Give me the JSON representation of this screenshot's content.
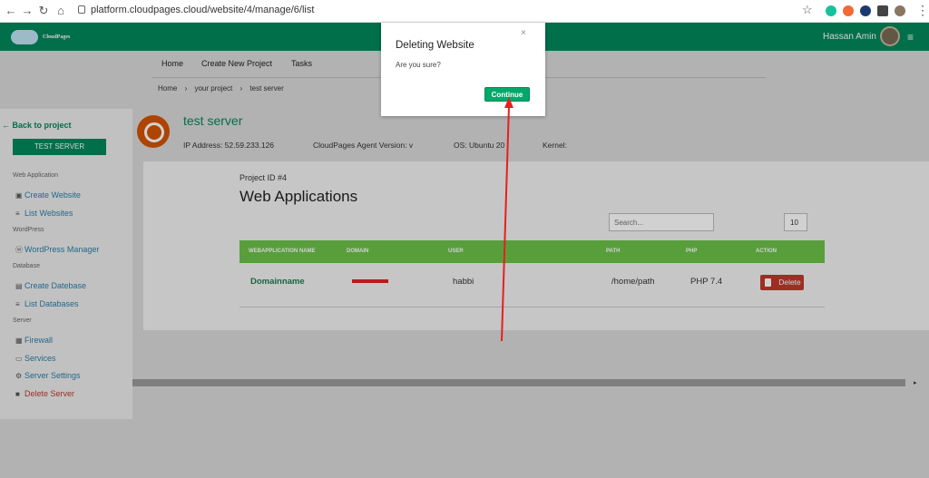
{
  "browser": {
    "url": "platform.cloudpages.cloud/website/4/manage/6/list"
  },
  "header": {
    "logo_text": "CloudPages",
    "user_name": "Hassan Amin"
  },
  "top_nav": {
    "items": [
      "Home",
      "Create New Project",
      "Tasks"
    ]
  },
  "breadcrumb": [
    "Home",
    "›",
    "your project",
    "›",
    "test server"
  ],
  "sidebar": {
    "back_label": "Back to project",
    "server_button": "TEST SERVER",
    "sections": {
      "web_application": "Web Application",
      "wordpress": "WordPress",
      "database": "Database",
      "server": "Server"
    },
    "items": {
      "create_website": "Create Website",
      "list_websites": "List Websites",
      "wordpress_manager": "WordPress Manager",
      "create_database": "Create Datebase",
      "list_databases": "List Databases",
      "firewall": "Firewall",
      "services": "Services",
      "server_settings": "Server Settings",
      "delete_server": "Delete Server"
    }
  },
  "server": {
    "title": "test server",
    "ip": "IP Address: 52.59.233.126",
    "agent": "CloudPages Agent Version: v",
    "os": "OS: Ubuntu 20",
    "kernel": "Kernel:"
  },
  "main": {
    "project_id": "Project ID #4",
    "heading": "Web Applications",
    "search_placeholder": "Search...",
    "page_size": "10",
    "columns": {
      "name": "WEBAPPLICATION NAME",
      "domain": "DOMAIN",
      "user": "USER",
      "path": "PATH",
      "php": "PHP",
      "action": "ACTION"
    },
    "row": {
      "name": "Domainname",
      "user": "habbi",
      "path": "/home/path",
      "php": "PHP 7.4",
      "delete_label": "Delete"
    }
  },
  "modal": {
    "title": "Deleting Website",
    "text": "Are you sure?",
    "close": "×",
    "continue_label": "Continue"
  },
  "colors": {
    "brand_green": "#00885b",
    "table_header": "#6cc24a",
    "delete_red": "#c0392b",
    "annotation_arrow": "#e81f1f"
  }
}
